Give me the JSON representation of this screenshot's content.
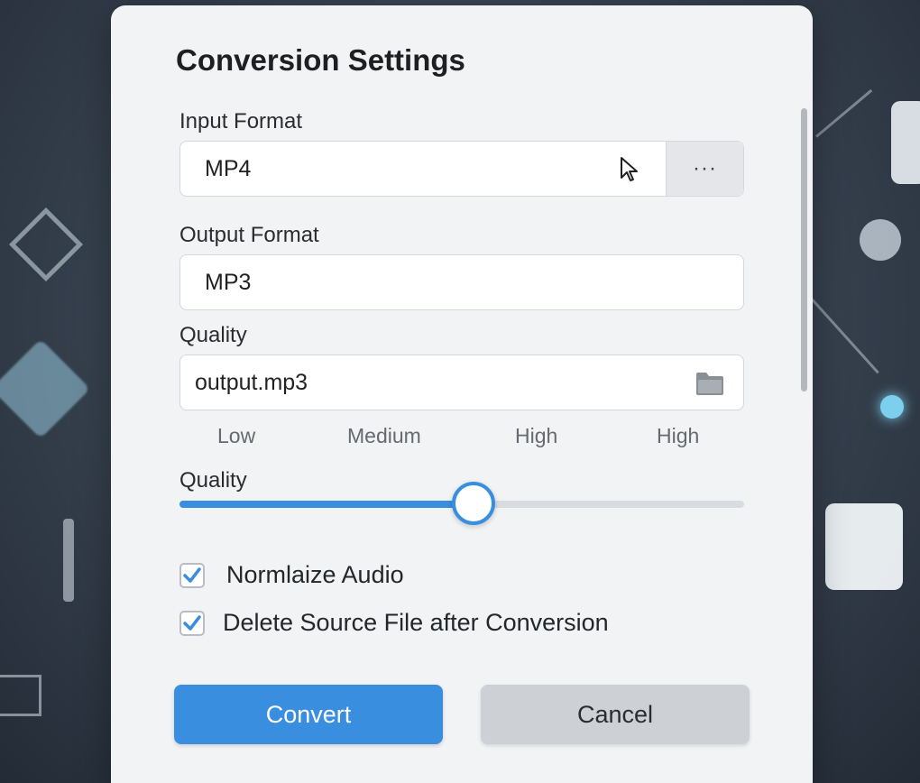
{
  "dialog": {
    "title": "Conversion Settings",
    "input_format": {
      "label": "Input Format",
      "value": "MP4",
      "more_button": "···"
    },
    "output_format": {
      "label": "Output Format",
      "value": "MP3"
    },
    "output_file": {
      "label": "Quality",
      "value": "output.mp3"
    },
    "quality_levels": [
      "Low",
      "Medium",
      "High",
      "High"
    ],
    "quality_slider": {
      "label": "Quality",
      "value": 0.52
    },
    "checkboxes": [
      {
        "label": "Normlaize Audio",
        "checked": true
      },
      {
        "label": "Delete Source File after Conversion",
        "checked": true
      }
    ],
    "convert_label": "Convert",
    "cancel_label": "Cancel"
  },
  "colors": {
    "accent": "#3a8ee0",
    "dialog_bg": "#f2f3f5",
    "cancel_bg": "#cdd1d6"
  },
  "icons": [
    "cursor-icon",
    "more-icon",
    "folder-icon",
    "checkmark-icon"
  ]
}
